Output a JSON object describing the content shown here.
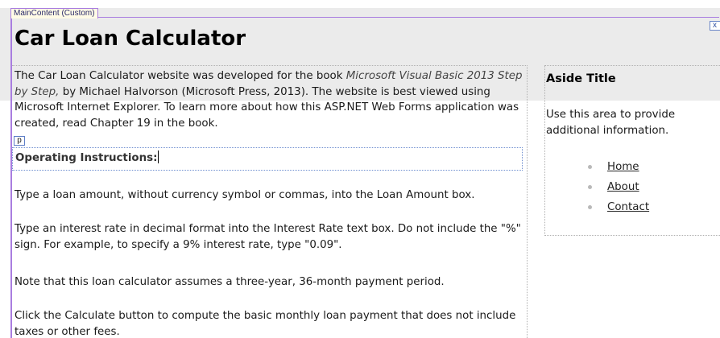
{
  "designer": {
    "region_tag": "MainContent (Custom)",
    "close_glyph": "x",
    "paragraph_tag": "p"
  },
  "page": {
    "title": "Car Loan Calculator"
  },
  "intro": {
    "text1": "The Car Loan Calculator website was developed for the book ",
    "book_title": "Microsoft Visual Basic 2013 Step by Step,",
    "text2": " by Michael Halvorson (Microsoft Press, 2013). The website is best viewed using Microsoft Internet Explorer. To learn more about how this ASP.NET Web Forms application was created, read Chapter 19 in the book."
  },
  "instructions": {
    "heading": "Operating Instructions:",
    "items": [
      "Type a loan amount, without currency symbol or commas, into the Loan Amount box.",
      "Type an interest rate in decimal format into the Interest Rate text box. Do not include the \"%\" sign. For example, to specify a 9% interest rate, type \"0.09\".",
      "Note that this loan calculator assumes a three-year, 36-month payment period.",
      "Click the Calculate button to compute the basic monthly loan payment that does not include taxes or other fees."
    ]
  },
  "aside": {
    "title": "Aside Title",
    "text": "Use this area to provide additional information.",
    "links": [
      "Home",
      "About",
      "Contact"
    ]
  },
  "colors": {
    "designer_outline": "#a97de0",
    "header_band": "#ebebeb",
    "selection_outline": "#6f8fd0"
  }
}
